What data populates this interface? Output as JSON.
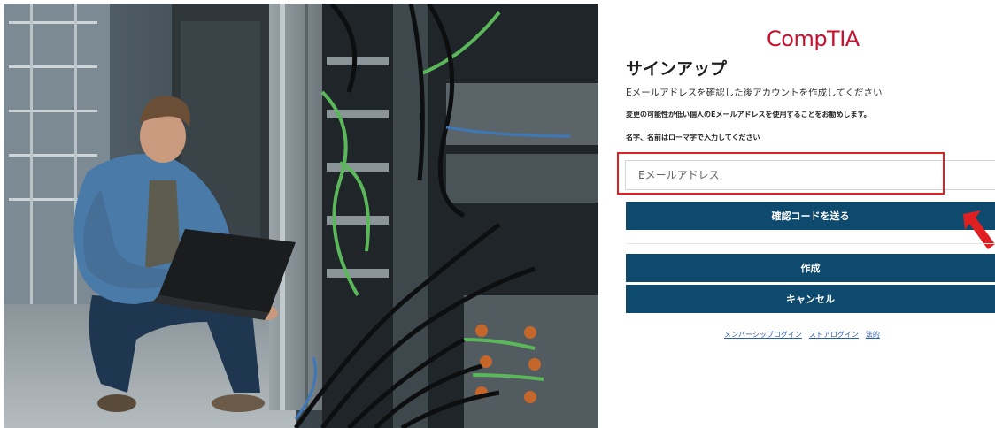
{
  "brand": {
    "logo_text": "CompTIA",
    "accent": "#c8102e",
    "button_color": "#0e4a6d"
  },
  "form": {
    "title": "サインアップ",
    "instruction": "Eメールアドレスを確認した後アカウントを作成してください",
    "notice": "変更の可能性が低い個人のEメールアドレスを使用することをお勧めします。",
    "name_hint": "名字、名前はローマ字で入力してください",
    "email_placeholder": "Eメールアドレス",
    "email_value": "",
    "send_code_label": "確認コードを送る",
    "create_label": "作成",
    "cancel_label": "キャンセル"
  },
  "footer_links": [
    "メンバーシップログイン",
    "ストアログイン",
    "法的"
  ],
  "annotations": {
    "highlight_color": "#e02020",
    "arrow_icon": "red-arrow-icon"
  },
  "hero": {
    "image": "photo-man-with-laptop-in-server-room"
  }
}
